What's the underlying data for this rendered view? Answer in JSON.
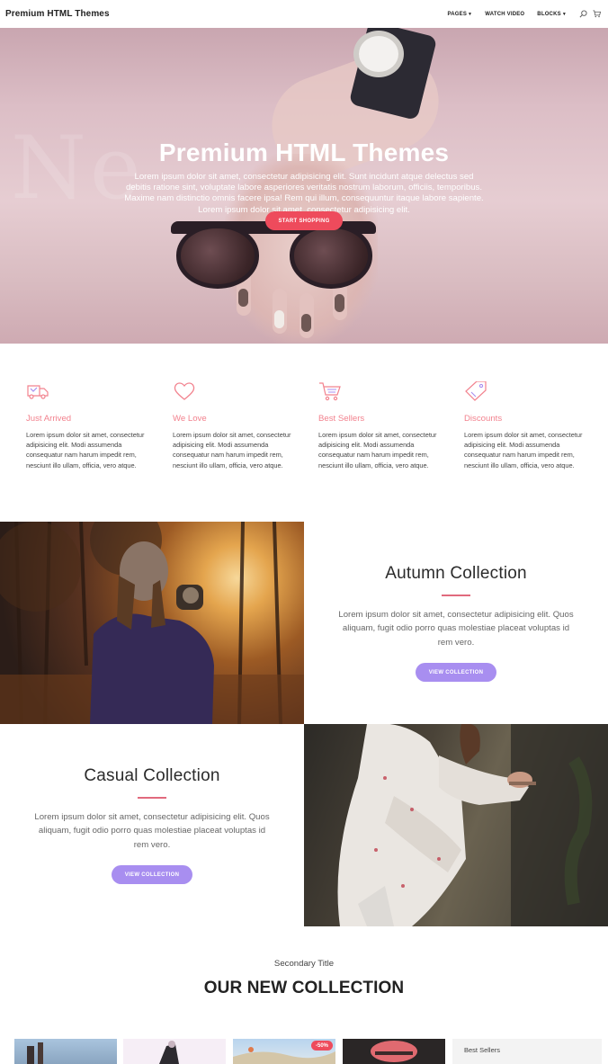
{
  "nav": {
    "brand": "Premium HTML Themes",
    "links": [
      "PAGES",
      "WATCH VIDEO",
      "BLOCKS"
    ],
    "icons": [
      "search-icon",
      "cart-icon"
    ]
  },
  "hero": {
    "title": "Premium HTML Themes",
    "text": "Lorem ipsum dolor sit amet, consectetur adipisicing elit. Sunt incidunt atque delectus sed debitis ratione sint, voluptate labore asperiores veritatis nostrum laborum, officiis, temporibus. Maxime nam distinctio omnis facere ipsa! Rem qui illum, consequuntur itaque labore sapiente. Lorem ipsum dolor sit amet, consectetur adipisicing elit.",
    "button": "START SHOPPING"
  },
  "features": [
    {
      "icon": "delivery-truck-icon",
      "title": "Just Arrived",
      "text": "Lorem ipsum dolor sit amet, consectetur adipisicing elit. Modi assumenda consequatur nam harum impedit rem, nesciunt illo ullam, officia, vero atque."
    },
    {
      "icon": "heart-icon",
      "title": "We Love",
      "text": "Lorem ipsum dolor sit amet, consectetur adipisicing elit. Modi assumenda consequatur nam harum impedit rem, nesciunt illo ullam, officia, vero atque."
    },
    {
      "icon": "shopping-cart-icon",
      "title": "Best Sellers",
      "text": "Lorem ipsum dolor sit amet, consectetur adipisicing elit. Modi assumenda consequatur nam harum impedit rem, nesciunt illo ullam, officia, vero atque."
    },
    {
      "icon": "price-tag-icon",
      "title": "Discounts",
      "text": "Lorem ipsum dolor sit amet, consectetur adipisicing elit. Modi assumenda consequatur nam harum impedit rem, nesciunt illo ullam, officia, vero atque."
    }
  ],
  "collections": {
    "autumn": {
      "title": "Autumn Collection",
      "text": "Lorem ipsum dolor sit amet, consectetur adipisicing elit. Quos aliquam, fugit odio porro quas molestiae placeat voluptas id rem vero.",
      "button": "VIEW COLLECTION"
    },
    "casual": {
      "title": "Casual Collection",
      "text": "Lorem ipsum dolor sit amet, consectetur adipisicing elit. Quos aliquam, fugit odio porro quas molestiae placeat voluptas id rem vero.",
      "button": "VIEW COLLECTION"
    }
  },
  "new_collection": {
    "subtitle": "Secondary Title",
    "title": "OUR NEW COLLECTION",
    "sale_badge": "-50%",
    "sidebar_title": "Best Sellers"
  },
  "colors": {
    "accent_pink": "#ee4b5c",
    "feature_title": "#f2828e",
    "button_purple": "#a88ef0",
    "divider": "#e16a7d"
  }
}
